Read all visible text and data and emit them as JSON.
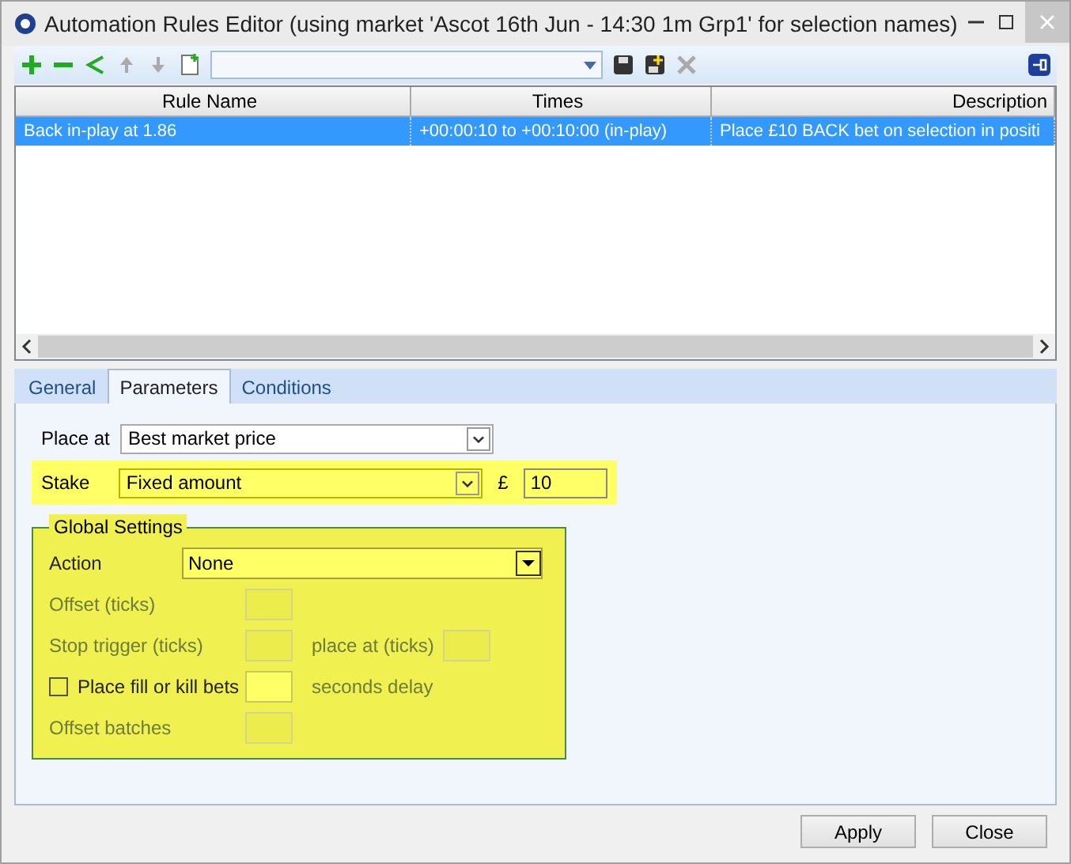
{
  "window": {
    "title": "Automation Rules Editor (using market 'Ascot 16th Jun - 14:30 1m Grp1' for selection names)"
  },
  "table": {
    "columns": [
      "Rule Name",
      "Times",
      "Description"
    ],
    "rows": [
      {
        "cells": [
          "Back in-play at 1.86",
          "+00:00:10 to +00:10:00 (in-play)",
          "Place £10 BACK bet on selection in positi"
        ],
        "selected": true
      }
    ]
  },
  "tabs": [
    {
      "label": "General",
      "selected": false
    },
    {
      "label": "Parameters",
      "selected": true
    },
    {
      "label": "Conditions",
      "selected": false
    }
  ],
  "place_at": {
    "label": "Place at",
    "value": "Best market price",
    "highlighted": false
  },
  "stake": {
    "label": "Stake",
    "value": "Fixed amount",
    "currency": "£",
    "amount": "10",
    "highlighted": true
  },
  "global_settings": {
    "title": "Global Settings",
    "highlighted": true,
    "action": {
      "label": "Action",
      "value": "None"
    },
    "rows": [
      {
        "kind": "field",
        "label": "Offset (ticks)",
        "disabled": true
      },
      {
        "kind": "pair",
        "label": "Stop trigger (ticks)",
        "label_2": "place at (ticks)",
        "disabled": true
      },
      {
        "kind": "check",
        "label": "Place fill or kill bets",
        "checked": false,
        "suffix": "seconds delay",
        "disabled": false,
        "suffix_disabled": true
      },
      {
        "kind": "field",
        "label": "Offset batches",
        "disabled": true
      }
    ]
  },
  "buttons": [
    "Apply",
    "Close"
  ]
}
